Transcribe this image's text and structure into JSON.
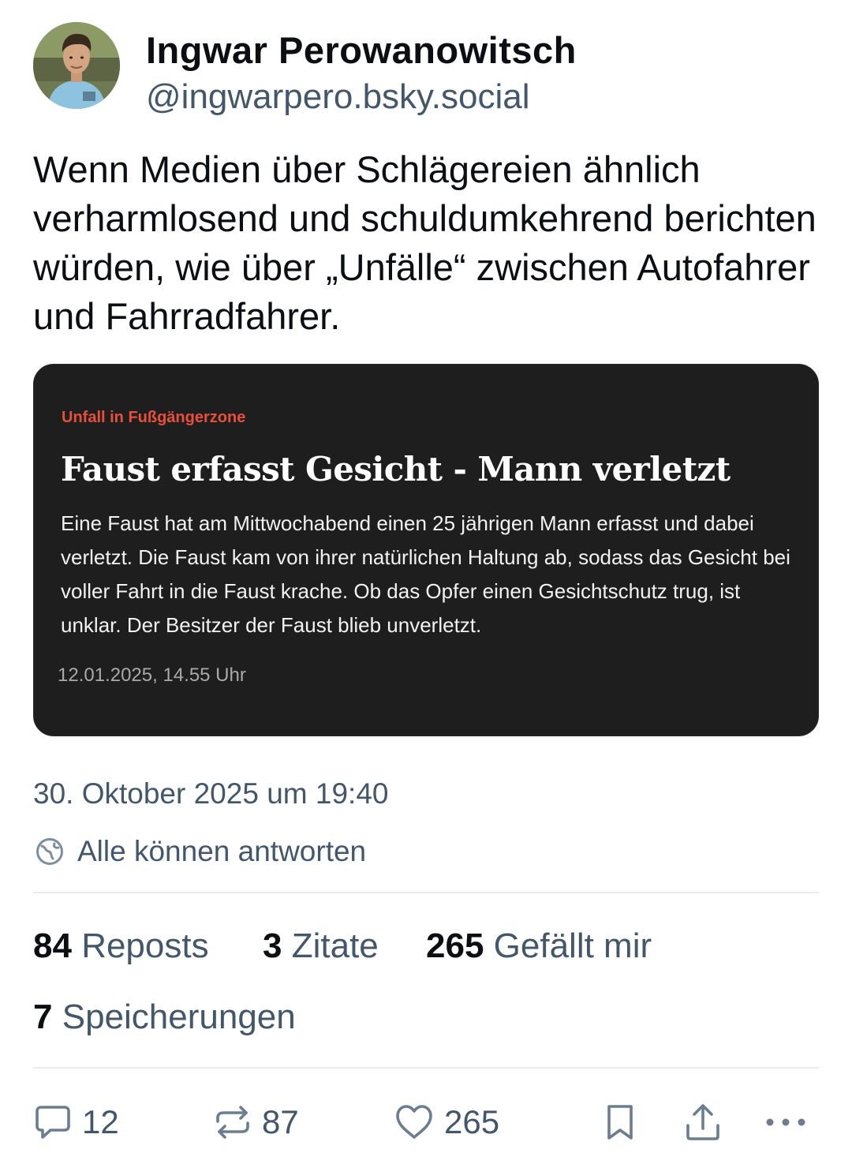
{
  "author": {
    "display_name": "Ingwar Perowanowitsch",
    "handle": "@ingwarpero.bsky.social"
  },
  "post": {
    "text": "Wenn Medien über Schlägereien ähnlich verharmlosend und schuldumkehrend berichten würden, wie über „Unfälle“ zwischen Autofahrer und Fahrradfahrer."
  },
  "embed": {
    "kicker": "Unfall in Fußgängerzone",
    "headline": "Faust erfasst Gesicht - Mann verletzt",
    "body": "Eine Faust hat am Mittwochabend einen 25 jährigen Mann erfasst und dabei verletzt. Die Faust kam von ihrer natürlichen Haltung ab, sodass das Gesicht bei voller Fahrt in die Faust krache. Ob das Opfer einen Gesichtschutz trug, ist unklar. Der Besitzer der Faust blieb unverletzt.",
    "date": "12.01.2025, 14.55 Uhr",
    "kicker_color": "#e8503a",
    "background": "#1e1e1e"
  },
  "meta": {
    "timestamp": "30. Oktober 2025 um 19:40",
    "reply_setting": "Alle können antworten",
    "reply_icon": "globe-icon"
  },
  "stats": {
    "reposts_count": "84",
    "reposts_label": "Reposts",
    "quotes_count": "3",
    "quotes_label": "Zitate",
    "likes_count": "265",
    "likes_label": "Gefällt mir",
    "saves_count": "7",
    "saves_label": "Speicherungen"
  },
  "actions": {
    "reply_count": "12",
    "repost_count": "87",
    "like_count": "265",
    "icons": [
      "reply-icon",
      "repost-icon",
      "like-icon",
      "bookmark-icon",
      "share-icon",
      "more-icon"
    ]
  },
  "colors": {
    "text_primary": "#0b0f14",
    "text_secondary": "#42576c",
    "divider": "#e8ecef"
  }
}
